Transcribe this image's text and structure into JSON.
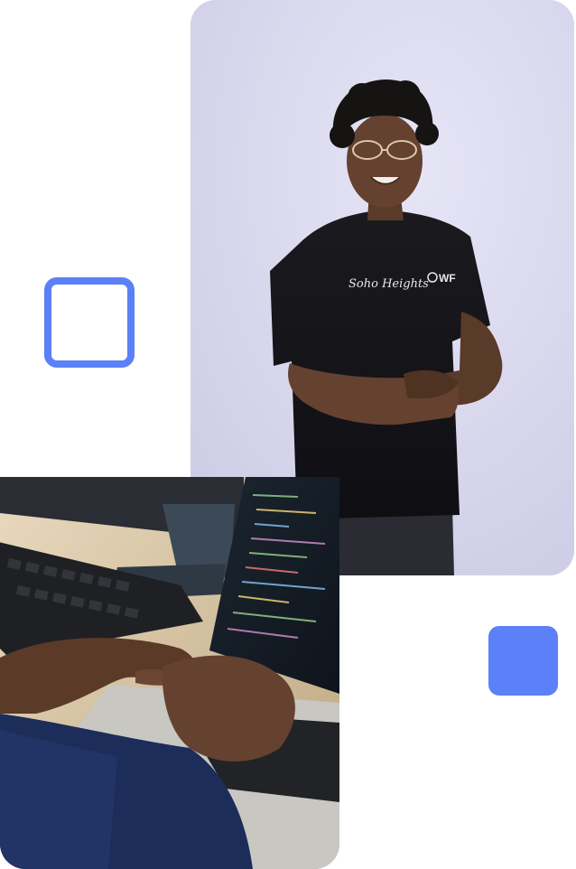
{
  "colors": {
    "accent": "#5b80f7",
    "backdrop": "#d9d8ee",
    "page": "#ffffff"
  },
  "person_photo": {
    "shirt_print_left": "Soho Heights",
    "shirt_print_right": "WF"
  }
}
